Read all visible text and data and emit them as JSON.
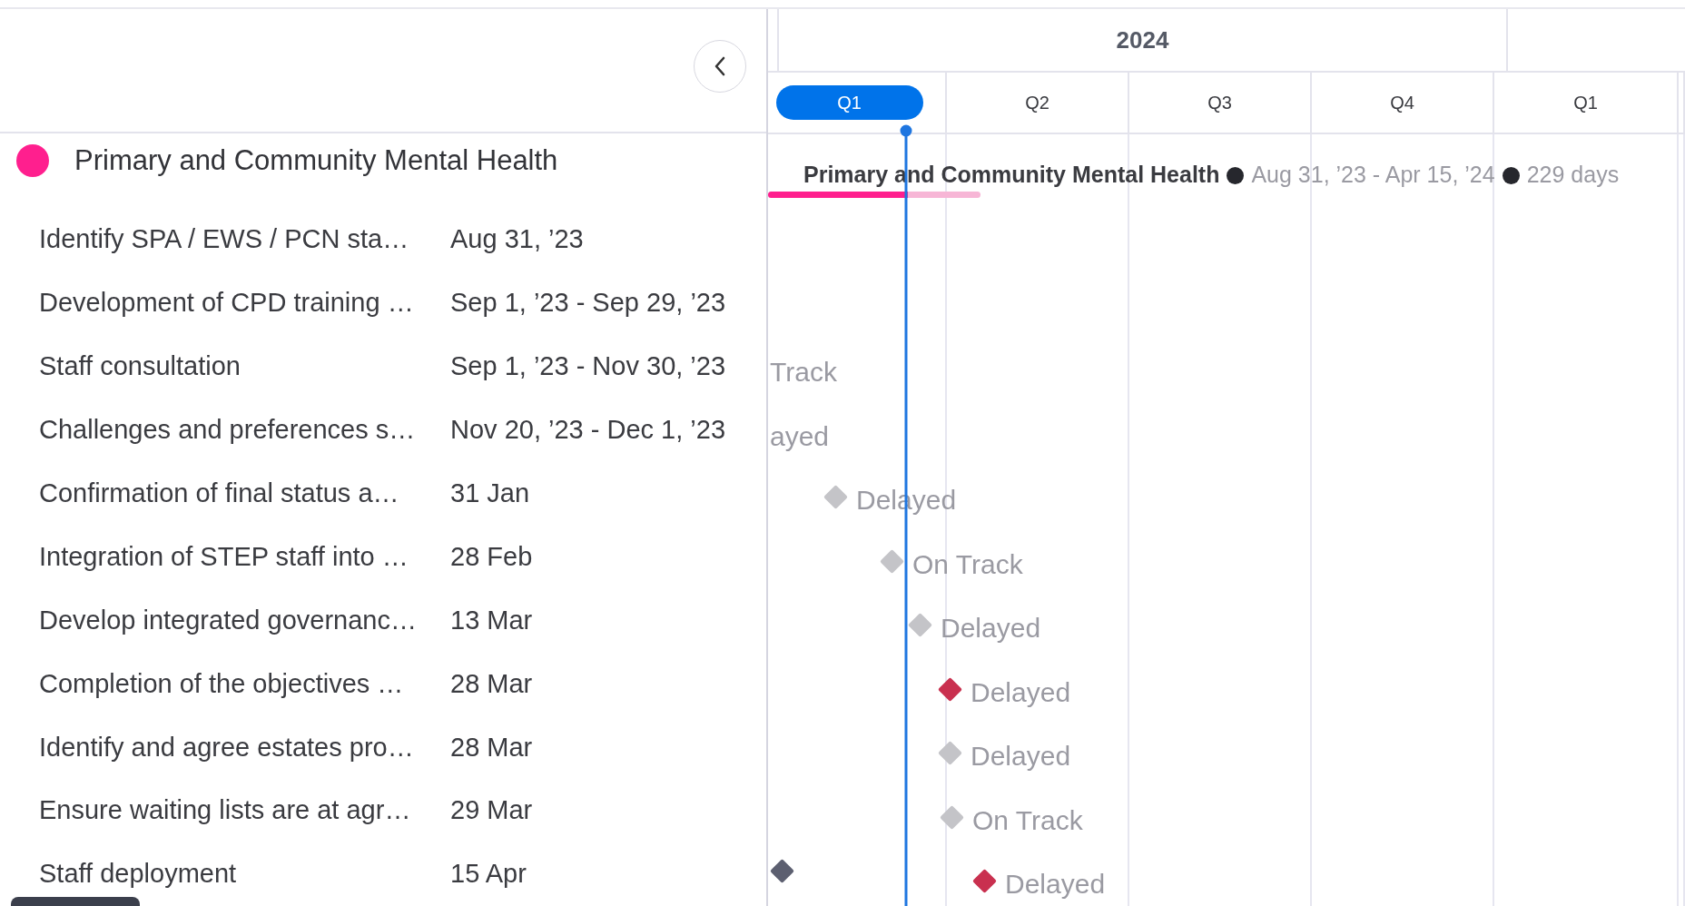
{
  "timeline": {
    "year": "2024",
    "quarters": [
      {
        "label": "Q1",
        "selected": true
      },
      {
        "label": "Q2",
        "selected": false
      },
      {
        "label": "Q3",
        "selected": false
      },
      {
        "label": "Q4",
        "selected": false
      },
      {
        "label": "Q1",
        "selected": false
      }
    ]
  },
  "group": {
    "name": "Primary and Community Mental Health",
    "color": "#ff1f8e",
    "bar": {
      "label": "Primary and Community Mental Health",
      "dates": "Aug 31, ’23 - Apr 15, ’24",
      "duration": "229 days",
      "level": 0.66
    }
  },
  "tasks": [
    {
      "name": "Identify SPA / EWS / PCN sta…",
      "date": "Aug 31, ’23",
      "kind": "none",
      "shadow_marker": false
    },
    {
      "name": "Development of CPD training …",
      "date": "Sep 1, ’23 - Sep 29, ’23",
      "kind": "none",
      "shadow_marker": false
    },
    {
      "name": "Staff consultation",
      "date": "Sep 1, ’23 - Nov 30, ’23",
      "kind": "none",
      "status": "Track",
      "shadow_marker": false
    },
    {
      "name": "Challenges and preferences s…",
      "date": "Nov 20, ’23 - Dec 1, ’23",
      "kind": "none",
      "status": "ayed",
      "shadow_marker": false
    },
    {
      "name": "Confirmation of final status a…",
      "date": "31 Jan",
      "kind": "grey",
      "status": "Delayed",
      "shadow_marker": false
    },
    {
      "name": "Integration of STEP staff into …",
      "date": "28 Feb",
      "kind": "grey",
      "status": "On Track",
      "shadow_marker": false
    },
    {
      "name": "Develop integrated governanc…",
      "date": "13 Mar",
      "kind": "grey",
      "status": "Delayed",
      "shadow_marker": false
    },
    {
      "name": "Completion of the objectives …",
      "date": "28 Mar",
      "kind": "red",
      "status": "Delayed",
      "shadow_marker": false
    },
    {
      "name": "Identify and agree estates pro…",
      "date": "28 Mar",
      "kind": "grey",
      "status": "Delayed",
      "shadow_marker": false
    },
    {
      "name": "Ensure waiting lists are at agr…",
      "date": "29 Mar",
      "kind": "grey",
      "status": "On Track",
      "shadow_marker": false
    },
    {
      "name": "Staff deployment",
      "date": "15 Apr",
      "kind": "red",
      "status": "Delayed",
      "shadow_marker": true
    }
  ]
}
